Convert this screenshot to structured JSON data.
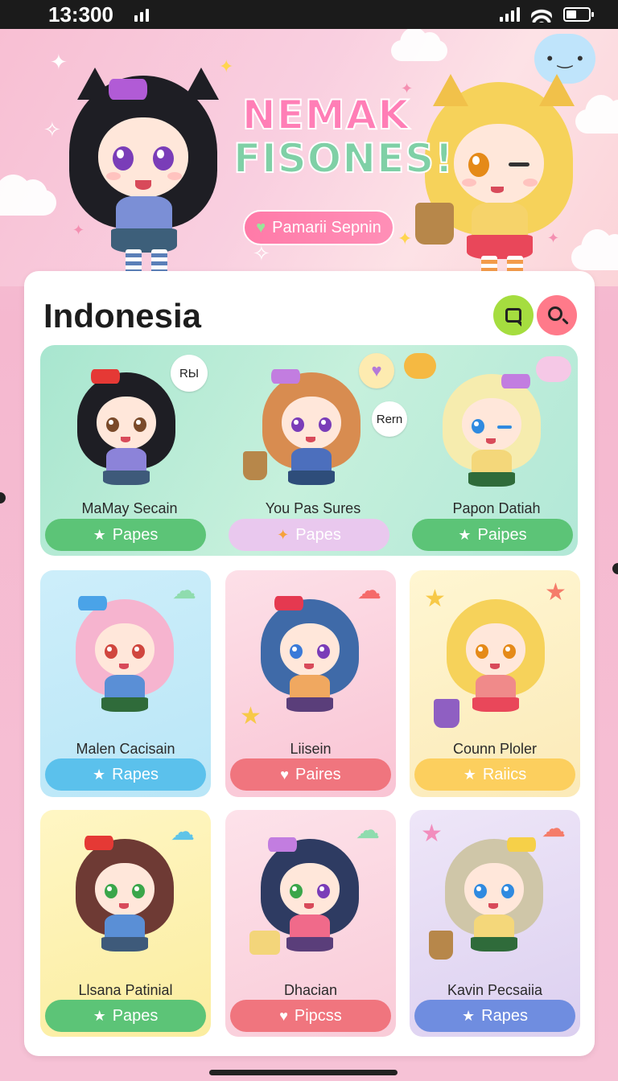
{
  "status_bar": {
    "time": "13:300"
  },
  "banner": {
    "title_line1": "NEMAK",
    "title_line2": "FISONES!",
    "subtitle": "Pamarii Sepnin"
  },
  "panel": {
    "title": "Indonesia"
  },
  "featured": [
    {
      "name": "MaMay Secain",
      "button": "Papes",
      "bubble": "RЫ",
      "button_color": "#5cc477",
      "button_icon": "star-icon"
    },
    {
      "name": "You Pas Sures",
      "button": "Papes",
      "bubble": "Rern",
      "button_color": "#e9c8ee",
      "button_icon": "sparkle-icon"
    },
    {
      "name": "Papon Datiah",
      "button": "Paipes",
      "button_color": "#5cc477",
      "button_icon": "star-icon"
    }
  ],
  "cards": [
    {
      "name": "Malen Cacisain",
      "button": "Rapes",
      "bg": "#c8edf7",
      "button_color": "#5bc1ec",
      "button_icon": "star-icon"
    },
    {
      "name": "Liisein",
      "button": "Paires",
      "bg": "#fbd2de",
      "button_color": "#f0757e",
      "button_icon": "heart-icon"
    },
    {
      "name": "Counn Ploler",
      "button": "Raiics",
      "bg": "#fdf2c6",
      "button_color": "#fccf5e",
      "button_icon": "star-icon"
    },
    {
      "name": "Llsana Patinial",
      "button": "Papes",
      "bg": "#fdf3bf",
      "button_color": "#5cc477",
      "button_icon": "star-icon"
    },
    {
      "name": "Dhacian",
      "button": "Pipcss",
      "bg": "#fcd6e0",
      "button_color": "#f0757e",
      "button_icon": "heart-icon"
    },
    {
      "name": "Kavin Pecsaiia",
      "button": "Rapes",
      "bg": "#e4dcf4",
      "button_color": "#6f8de0",
      "button_icon": "star-icon"
    }
  ]
}
